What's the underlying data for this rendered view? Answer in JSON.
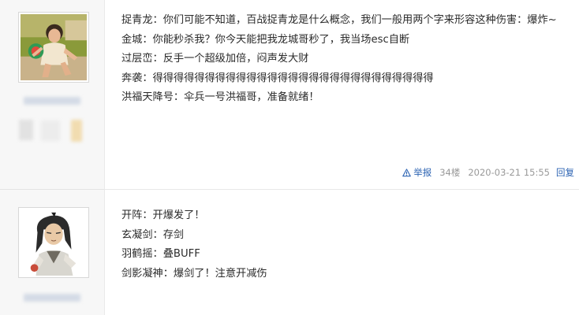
{
  "posts": [
    {
      "avatar": "user-avatar-photo",
      "lines": [
        "捉青龙：你们可能不知道，百战捉青龙是什么概念，我们一般用两个字来形容这种伤害：爆炸~",
        "金城：你能秒杀我？你今天能把我龙城哥秒了，我当场esc自断",
        "过层峦：反手一个超级加倍，闷声发大财",
        "奔袭：得得得得得得得得得得得得得得得得得得得得得得得得得得得",
        "洪福天降号：伞兵一号洪福哥，准备就绪！"
      ],
      "footer": {
        "report": "举报",
        "floor": "34楼",
        "time": "2020-03-21 15:55",
        "reply": "回复"
      }
    },
    {
      "avatar": "user-avatar-game-character",
      "lines": [
        "开阵：开爆发了！",
        "玄凝剑：存剑",
        "羽鹤摇：叠BUFF",
        "剑影凝神：爆剑了！注意开减伤"
      ]
    }
  ],
  "colors": {
    "link": "#2d64b3",
    "meta": "#999999",
    "sidebar": "#f7f7f7"
  }
}
